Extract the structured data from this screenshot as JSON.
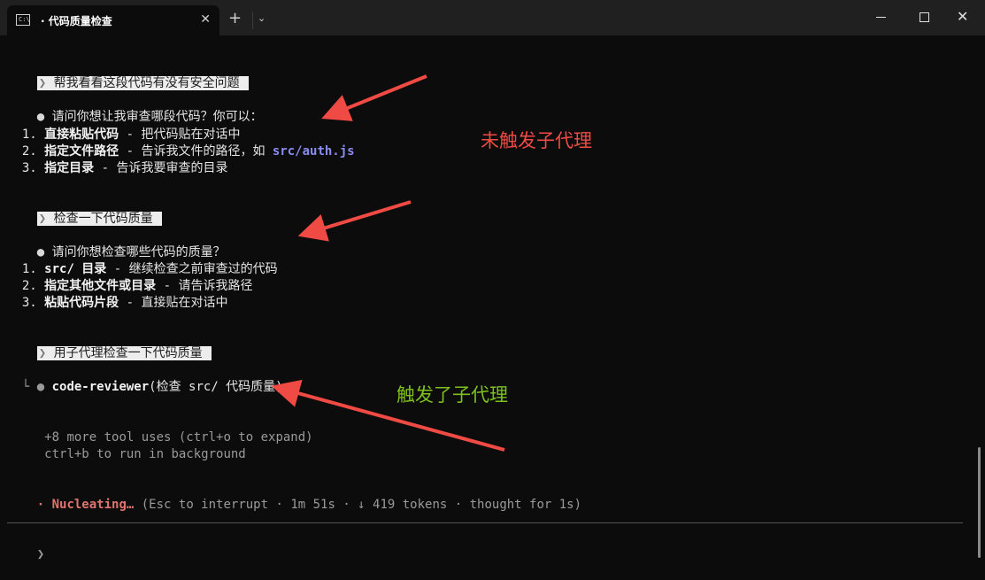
{
  "window": {
    "tab_title": "· 代码质量检查",
    "tab_close": "✕",
    "new_tab": "+",
    "dropdown": "⌄",
    "close": "✕"
  },
  "conversation": [
    {
      "user": "帮我看看这段代码有没有安全问题"
    },
    {
      "assistant": "请问你想让我审查哪段代码？你可以："
    },
    {
      "item1_num": "1.",
      "item1_bold": "直接粘贴代码",
      "item1_rest": " - 把代码贴在对话中"
    },
    {
      "item2_num": "2.",
      "item2_bold": "指定文件路径",
      "item2_rest": " - 告诉我文件的路径，如 ",
      "item2_link": "src/auth.js"
    },
    {
      "item3_num": "3.",
      "item3_bold": "指定目录",
      "item3_rest": " - 告诉我要审查的目录"
    }
  ],
  "msg1": {
    "user": "帮我看看这段代码有没有安全问题",
    "reply": "请问你想让我审查哪段代码？你可以：",
    "items": [
      {
        "num": "1.",
        "bold": "直接粘贴代码",
        "rest": " - 把代码贴在对话中"
      },
      {
        "num": "2.",
        "bold": "指定文件路径",
        "rest": " - 告诉我文件的路径，如 ",
        "link": "src/auth.js"
      },
      {
        "num": "3.",
        "bold": "指定目录",
        "rest": " - 告诉我要审查的目录"
      }
    ]
  },
  "msg2": {
    "user": "检查一下代码质量",
    "reply": "请问你想检查哪些代码的质量？",
    "items": [
      {
        "num": "1.",
        "bold": "src/ 目录",
        "rest": " - 继续检查之前审查过的代码"
      },
      {
        "num": "2.",
        "bold": "指定其他文件或目录",
        "rest": " - 请告诉我路径"
      },
      {
        "num": "3.",
        "bold": "粘贴代码片段",
        "rest": " - 直接贴在对话中"
      }
    ]
  },
  "msg3": {
    "user": "用子代理检查一下代码质量",
    "tool_name": "code-reviewer",
    "tool_args": "(检查 src/ 代码质量)",
    "tree_corner": "└",
    "more_tools": "+8 more tool uses (ctrl+o to expand)",
    "background_hint": "ctrl+b to run in background"
  },
  "status": {
    "dot": "·",
    "label": "Nucleating…",
    "details": " (Esc to interrupt · 1m 51s · ↓ 419 tokens · thought for 1s)"
  },
  "prompt": {
    "symbol": "❯"
  },
  "chev": "❯",
  "bullet": "●",
  "annotations": {
    "not_triggered": "未触发子代理",
    "triggered": "触发了子代理",
    "red_color": "#ef4a44",
    "green_color": "#7fbf1e"
  }
}
